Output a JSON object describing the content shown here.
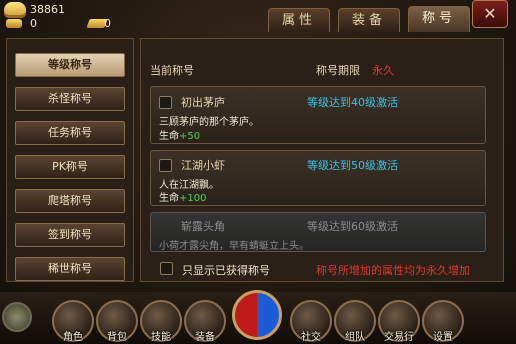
{
  "currency": {
    "gold": "38861",
    "coin": "0",
    "ingot": "0"
  },
  "tabs": [
    {
      "label": "属性"
    },
    {
      "label": "装备"
    },
    {
      "label": "称号"
    }
  ],
  "close_icon": "close-icon",
  "sidebar": {
    "items": [
      {
        "label": "等级称号"
      },
      {
        "label": "杀怪称号"
      },
      {
        "label": "任务称号"
      },
      {
        "label": "PK称号"
      },
      {
        "label": "爬塔称号"
      },
      {
        "label": "签到称号"
      },
      {
        "label": "稀世称号"
      }
    ]
  },
  "panel": {
    "current_label": "当前称号",
    "period_label": "称号期限",
    "period_value": "永久",
    "titles": [
      {
        "name": "初出茅庐",
        "condition": "等级达到40级激活",
        "desc": "三顾茅庐的那个茅庐。",
        "stat_name": "生命",
        "stat_value": "+50"
      },
      {
        "name": "江湖小虾",
        "condition": "等级达到50级激活",
        "desc": "人在江湖飘。",
        "stat_name": "生命",
        "stat_value": "+100"
      },
      {
        "name": "崭露头角",
        "condition": "等级达到60级激活",
        "desc": "小荷才露尖角，早有蜻蜓立上头。"
      }
    ],
    "only_owned_label": "只显示已获得称号",
    "note": "称号所增加的属性均为永久增加"
  },
  "bottom_nav": [
    {
      "label": "角色"
    },
    {
      "label": "背包"
    },
    {
      "label": "技能"
    },
    {
      "label": "装备"
    },
    {
      "label": "社交"
    },
    {
      "label": "组队"
    },
    {
      "label": "交易行"
    },
    {
      "label": "设置"
    }
  ],
  "colors": {
    "accent_red": "#e0392c",
    "condition_blue": "#39c1e6",
    "stat_green": "#49d44a"
  }
}
